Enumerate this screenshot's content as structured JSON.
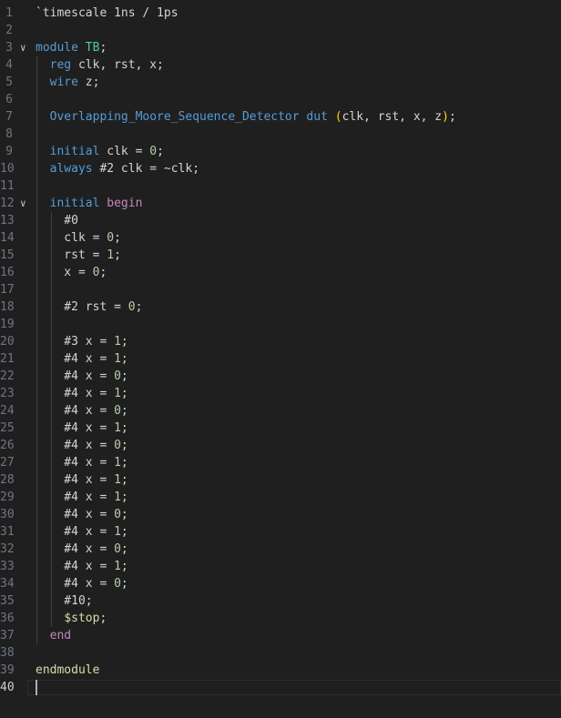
{
  "editor": {
    "language": "verilog",
    "cursor_line": 40,
    "colors": {
      "background": "#1f1f1f",
      "keyword": "#569cd6",
      "control": "#c586c0",
      "module": "#dcdcaa",
      "type": "#4ec9b0",
      "variable": "#9cdcfe",
      "number": "#b5cea8",
      "operator": "#d4d4d4",
      "bracket": "#ffd700",
      "line_number": "#6e7681"
    },
    "lines": [
      {
        "n": "1",
        "t": [
          [
            "op",
            "`timescale 1ns / 1ps"
          ]
        ]
      },
      {
        "n": "2",
        "t": []
      },
      {
        "n": "3",
        "fold": true,
        "t": [
          [
            "kw",
            "module"
          ],
          [
            "op",
            " "
          ],
          [
            "typ",
            "TB"
          ],
          [
            "op",
            ";"
          ]
        ]
      },
      {
        "n": "4",
        "t": [
          [
            "op",
            "  "
          ],
          [
            "kw",
            "reg"
          ],
          [
            "op",
            " clk, rst, x;"
          ]
        ]
      },
      {
        "n": "5",
        "t": [
          [
            "op",
            "  "
          ],
          [
            "kw",
            "wire"
          ],
          [
            "op",
            " z;"
          ]
        ]
      },
      {
        "n": "6",
        "t": []
      },
      {
        "n": "7",
        "t": [
          [
            "op",
            "  "
          ],
          [
            "kw",
            "Overlapping_Moore_Sequence_Detector"
          ],
          [
            "op",
            " "
          ],
          [
            "kw",
            "dut"
          ],
          [
            "op",
            " "
          ],
          [
            "pn",
            "("
          ],
          [
            "op",
            "clk, rst, x, z"
          ],
          [
            "pn",
            ")"
          ],
          [
            "op",
            ";"
          ]
        ]
      },
      {
        "n": "8",
        "t": []
      },
      {
        "n": "9",
        "t": [
          [
            "op",
            "  "
          ],
          [
            "kw",
            "initial"
          ],
          [
            "op",
            " clk = "
          ],
          [
            "num",
            "0"
          ],
          [
            "op",
            ";"
          ]
        ]
      },
      {
        "n": "10",
        "t": [
          [
            "op",
            "  "
          ],
          [
            "kw",
            "always"
          ],
          [
            "op",
            " #2 clk = ~clk;"
          ]
        ]
      },
      {
        "n": "11",
        "t": []
      },
      {
        "n": "12",
        "fold": true,
        "t": [
          [
            "op",
            "  "
          ],
          [
            "kw",
            "initial"
          ],
          [
            "op",
            " "
          ],
          [
            "ctl",
            "begin"
          ]
        ]
      },
      {
        "n": "13",
        "t": [
          [
            "op",
            "    #0"
          ]
        ]
      },
      {
        "n": "14",
        "t": [
          [
            "op",
            "    clk = "
          ],
          [
            "num",
            "0"
          ],
          [
            "op",
            ";"
          ]
        ]
      },
      {
        "n": "15",
        "t": [
          [
            "op",
            "    rst = "
          ],
          [
            "num",
            "1"
          ],
          [
            "op",
            ";"
          ]
        ]
      },
      {
        "n": "16",
        "t": [
          [
            "op",
            "    x = "
          ],
          [
            "num",
            "0"
          ],
          [
            "op",
            ";"
          ]
        ]
      },
      {
        "n": "17",
        "t": []
      },
      {
        "n": "18",
        "t": [
          [
            "op",
            "    #2 rst = "
          ],
          [
            "num",
            "0"
          ],
          [
            "op",
            ";"
          ]
        ]
      },
      {
        "n": "19",
        "t": []
      },
      {
        "n": "20",
        "t": [
          [
            "op",
            "    #3 x = "
          ],
          [
            "num",
            "1"
          ],
          [
            "op",
            ";"
          ]
        ]
      },
      {
        "n": "21",
        "t": [
          [
            "op",
            "    #4 x = "
          ],
          [
            "num",
            "1"
          ],
          [
            "op",
            ";"
          ]
        ]
      },
      {
        "n": "22",
        "t": [
          [
            "op",
            "    #4 x = "
          ],
          [
            "num",
            "0"
          ],
          [
            "op",
            ";"
          ]
        ]
      },
      {
        "n": "23",
        "t": [
          [
            "op",
            "    #4 x = "
          ],
          [
            "num",
            "1"
          ],
          [
            "op",
            ";"
          ]
        ]
      },
      {
        "n": "24",
        "t": [
          [
            "op",
            "    #4 x = "
          ],
          [
            "num",
            "0"
          ],
          [
            "op",
            ";"
          ]
        ]
      },
      {
        "n": "25",
        "t": [
          [
            "op",
            "    #4 x = "
          ],
          [
            "num",
            "1"
          ],
          [
            "op",
            ";"
          ]
        ]
      },
      {
        "n": "26",
        "t": [
          [
            "op",
            "    #4 x = "
          ],
          [
            "num",
            "0"
          ],
          [
            "op",
            ";"
          ]
        ]
      },
      {
        "n": "27",
        "t": [
          [
            "op",
            "    #4 x = "
          ],
          [
            "num",
            "1"
          ],
          [
            "op",
            ";"
          ]
        ]
      },
      {
        "n": "28",
        "t": [
          [
            "op",
            "    #4 x = "
          ],
          [
            "num",
            "1"
          ],
          [
            "op",
            ";"
          ]
        ]
      },
      {
        "n": "29",
        "t": [
          [
            "op",
            "    #4 x = "
          ],
          [
            "num",
            "1"
          ],
          [
            "op",
            ";"
          ]
        ]
      },
      {
        "n": "30",
        "t": [
          [
            "op",
            "    #4 x = "
          ],
          [
            "num",
            "0"
          ],
          [
            "op",
            ";"
          ]
        ]
      },
      {
        "n": "31",
        "t": [
          [
            "op",
            "    #4 x = "
          ],
          [
            "num",
            "1"
          ],
          [
            "op",
            ";"
          ]
        ]
      },
      {
        "n": "32",
        "t": [
          [
            "op",
            "    #4 x = "
          ],
          [
            "num",
            "0"
          ],
          [
            "op",
            ";"
          ]
        ]
      },
      {
        "n": "33",
        "t": [
          [
            "op",
            "    #4 x = "
          ],
          [
            "num",
            "1"
          ],
          [
            "op",
            ";"
          ]
        ]
      },
      {
        "n": "34",
        "t": [
          [
            "op",
            "    #4 x = "
          ],
          [
            "num",
            "0"
          ],
          [
            "op",
            ";"
          ]
        ]
      },
      {
        "n": "35",
        "t": [
          [
            "op",
            "    #10;"
          ]
        ]
      },
      {
        "n": "36",
        "t": [
          [
            "op",
            "    "
          ],
          [
            "sys",
            "$stop"
          ],
          [
            "op",
            ";"
          ]
        ]
      },
      {
        "n": "37",
        "t": [
          [
            "op",
            "  "
          ],
          [
            "ctl",
            "end"
          ]
        ]
      },
      {
        "n": "38",
        "t": []
      },
      {
        "n": "39",
        "t": [
          [
            "mod",
            "endmodule"
          ]
        ]
      },
      {
        "n": "40",
        "t": []
      }
    ]
  }
}
